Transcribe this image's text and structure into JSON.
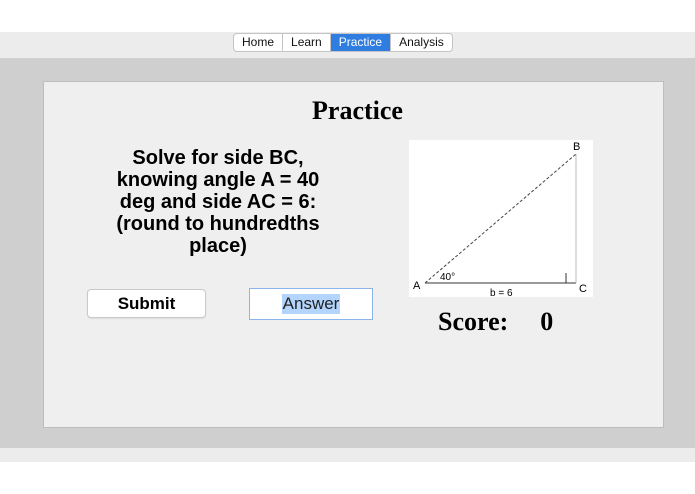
{
  "tabs": [
    {
      "label": "Home",
      "active": false
    },
    {
      "label": "Learn",
      "active": false
    },
    {
      "label": "Practice",
      "active": true
    },
    {
      "label": "Analysis",
      "active": false
    }
  ],
  "page": {
    "title": "Practice"
  },
  "question": {
    "lines": [
      "Solve for side BC,",
      "knowing angle A = 40",
      "deg and side AC = 6:",
      "(round to hundredths",
      "place)"
    ]
  },
  "submit": {
    "label": "Submit"
  },
  "answer": {
    "placeholder": "Answer",
    "value": "Answer"
  },
  "diagram": {
    "vertex_a": "A",
    "vertex_b": "B",
    "vertex_c": "C",
    "angle_label": "40°",
    "side_label": "b = 6"
  },
  "score": {
    "label": "Score:",
    "value": "0"
  },
  "colors": {
    "accent": "#2f7de1",
    "selection": "#b3d4fc"
  }
}
